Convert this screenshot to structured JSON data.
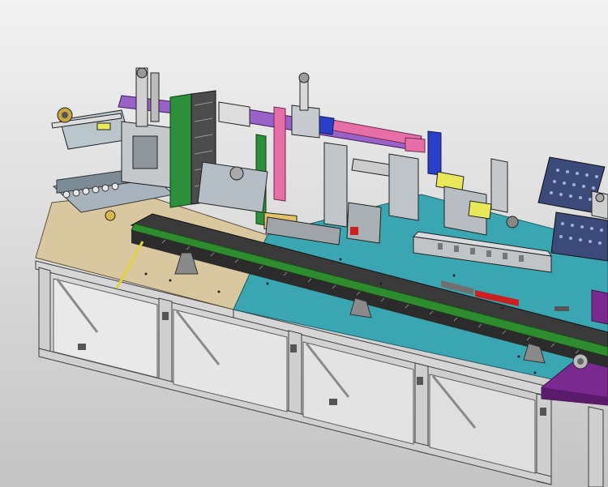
{
  "scene": {
    "subject": "automated-assembly-machine",
    "view": "isometric-cad-render"
  },
  "colors": {
    "background_top": "#f2f2f2",
    "background_bottom": "#c4c4c4",
    "frame": "#d6d6d6",
    "frame_edge": "#3c3c3c",
    "plate_tan": "#d9c7a0",
    "plate_teal": "#3aa6b2",
    "plate_purple": "#7a2a8e",
    "conveyor_green": "#2e8b2e",
    "conveyor_dark": "#2b2b2b",
    "module_gray": "#9ea4a8",
    "accent_purple": "#9a62c8",
    "accent_blue": "#2a3fc8",
    "accent_pink": "#e76fa8",
    "accent_yellow": "#e8e85a",
    "accent_red": "#cc1f1f",
    "tray_blue": "#3b4a78"
  }
}
